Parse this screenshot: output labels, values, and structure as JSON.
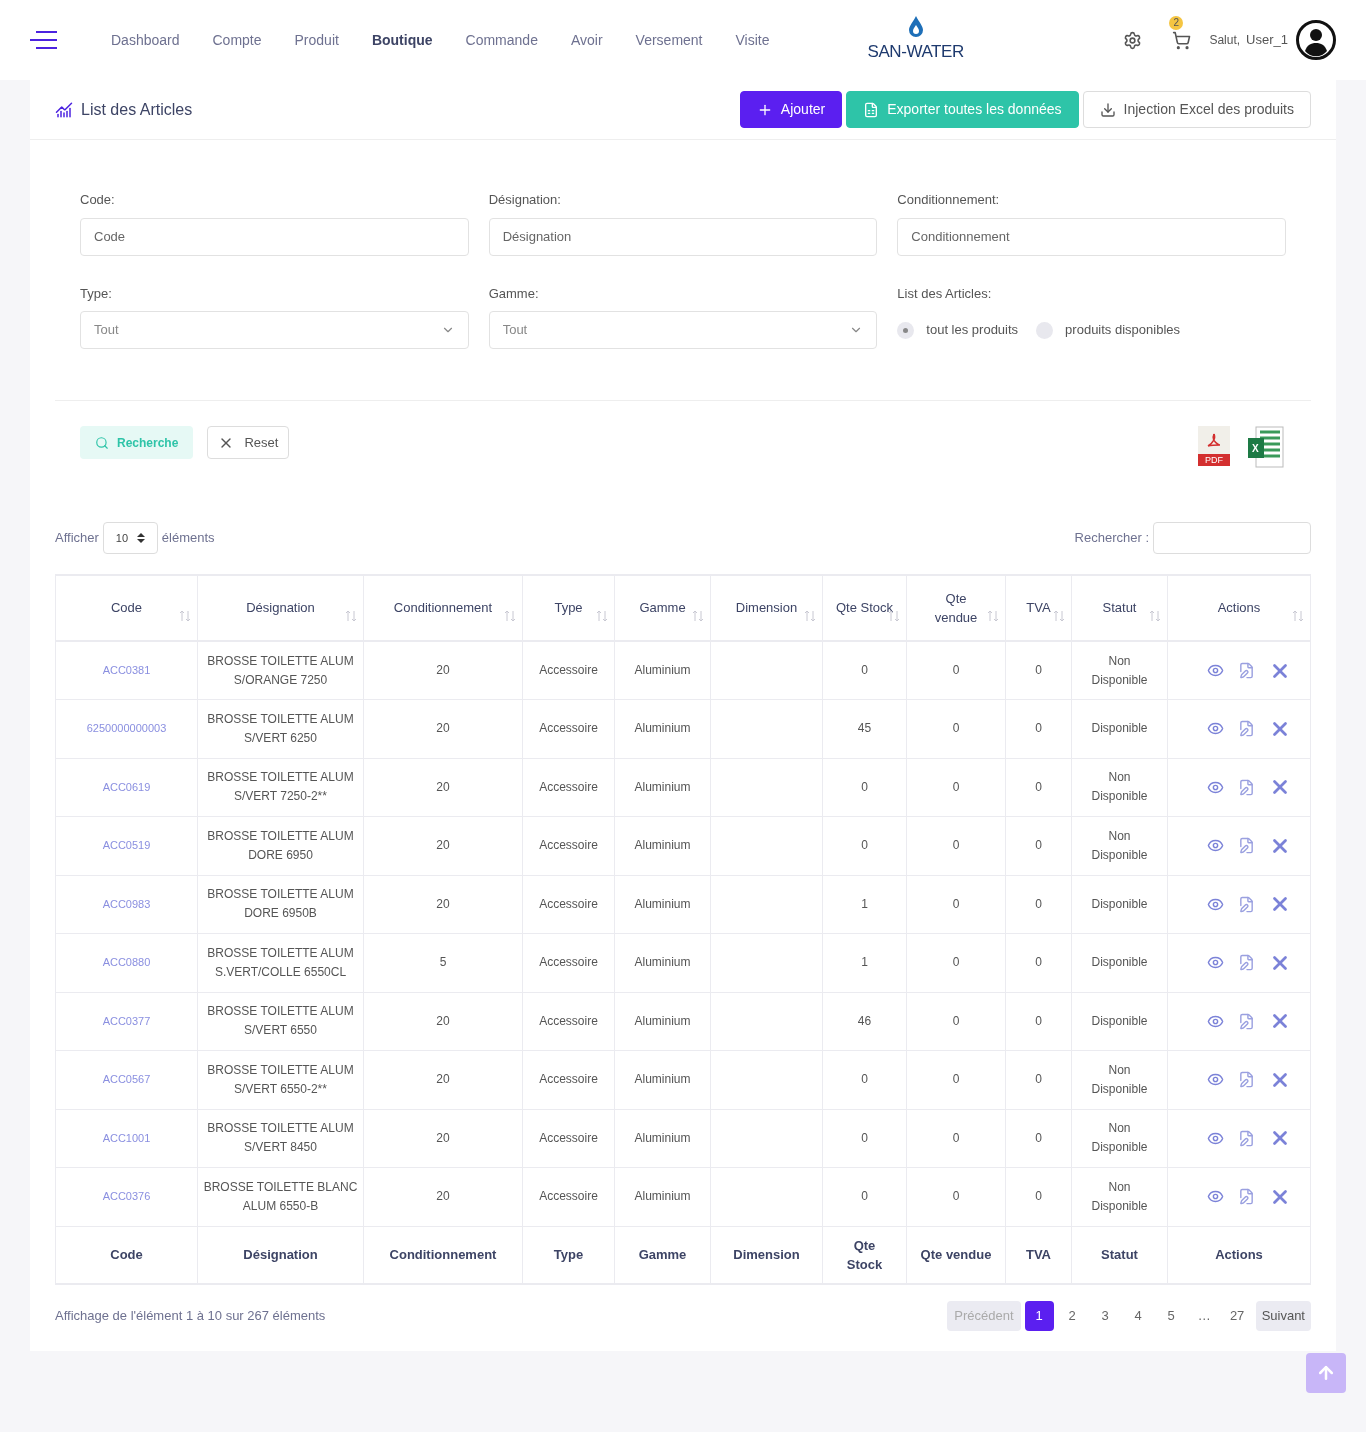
{
  "nav": {
    "items": [
      {
        "label": "Dashboard",
        "selected": false
      },
      {
        "label": "Compte",
        "selected": false
      },
      {
        "label": "Produit",
        "selected": false
      },
      {
        "label": "Boutique",
        "selected": true
      },
      {
        "label": "Commande",
        "selected": false
      },
      {
        "label": "Avoir",
        "selected": false
      },
      {
        "label": "Versement",
        "selected": false
      },
      {
        "label": "Visite",
        "selected": false
      }
    ],
    "logo": "SAN-WATER",
    "cart_count": "2",
    "greeting": "Salut,",
    "user": "User_1"
  },
  "page": {
    "title": "List des Articles",
    "buttons": [
      {
        "label": "Ajouter",
        "kind": "add"
      },
      {
        "label": "Exporter toutes les données",
        "kind": "export"
      },
      {
        "label": "Injection Excel des produits",
        "kind": "import"
      }
    ]
  },
  "filters": {
    "fields": [
      {
        "label": "Code:",
        "placeholder": "Code",
        "kind": "text"
      },
      {
        "label": "Désignation:",
        "placeholder": "Désignation",
        "kind": "text"
      },
      {
        "label": "Conditionnement:",
        "placeholder": "Conditionnement",
        "kind": "text"
      },
      {
        "label": "Type:",
        "value": "Tout",
        "kind": "select"
      },
      {
        "label": "Gamme:",
        "value": "Tout",
        "kind": "select"
      }
    ],
    "radio_label": "List des Articles:",
    "radios": [
      {
        "label": "tout les produits",
        "selected": true
      },
      {
        "label": "produits disponibles",
        "selected": false
      }
    ],
    "search_button": "Recherche",
    "reset_button": "Reset",
    "pdf_label": "PDF",
    "excel_label": "X"
  },
  "table": {
    "show_label": "Afficher",
    "page_size": "10",
    "elements_label": "éléments",
    "search_label": "Rechercher :",
    "columns": [
      "Code",
      "Désignation",
      "Conditionnement",
      "Type",
      "Gamme",
      "Dimension",
      "Qte Stock",
      "Qte vendue",
      "TVA",
      "Statut",
      "Actions"
    ],
    "rows": [
      [
        "ACC0381",
        "BROSSE TOILETTE ALUM S/ORANGE 7250",
        "20",
        "Accessoire",
        "Aluminium",
        "",
        "0",
        "0",
        "0",
        "Non Disponible"
      ],
      [
        "6250000000003",
        "BROSSE TOILETTE ALUM S/VERT 6250",
        "20",
        "Accessoire",
        "Aluminium",
        "",
        "45",
        "0",
        "0",
        "Disponible"
      ],
      [
        "ACC0619",
        "BROSSE TOILETTE ALUM S/VERT 7250-2**",
        "20",
        "Accessoire",
        "Aluminium",
        "",
        "0",
        "0",
        "0",
        "Non Disponible"
      ],
      [
        "ACC0519",
        "BROSSE TOILETTE ALUM DORE 6950",
        "20",
        "Accessoire",
        "Aluminium",
        "",
        "0",
        "0",
        "0",
        "Non Disponible"
      ],
      [
        "ACC0983",
        "BROSSE TOILETTE ALUM DORE 6950B",
        "20",
        "Accessoire",
        "Aluminium",
        "",
        "1",
        "0",
        "0",
        "Disponible"
      ],
      [
        "ACC0880",
        "BROSSE TOILETTE ALUM S.VERT/COLLE 6550CL",
        "5",
        "Accessoire",
        "Aluminium",
        "",
        "1",
        "0",
        "0",
        "Disponible"
      ],
      [
        "ACC0377",
        "BROSSE TOILETTE ALUM S/VERT 6550",
        "20",
        "Accessoire",
        "Aluminium",
        "",
        "46",
        "0",
        "0",
        "Disponible"
      ],
      [
        "ACC0567",
        "BROSSE TOILETTE ALUM S/VERT 6550-2**",
        "20",
        "Accessoire",
        "Aluminium",
        "",
        "0",
        "0",
        "0",
        "Non Disponible"
      ],
      [
        "ACC1001",
        "BROSSE TOILETTE ALUM S/VERT 8450",
        "20",
        "Accessoire",
        "Aluminium",
        "",
        "0",
        "0",
        "0",
        "Non Disponible"
      ],
      [
        "ACC0376",
        "BROSSE TOILETTE BLANC ALUM 6550-B",
        "20",
        "Accessoire",
        "Aluminium",
        "",
        "0",
        "0",
        "0",
        "Non Disponible"
      ]
    ],
    "footer_columns": [
      "Code",
      "Désignation",
      "Conditionnement",
      "Type",
      "Gamme",
      "Dimension",
      "Qte Stock",
      "Qte vendue",
      "TVA",
      "Statut",
      "Actions"
    ]
  },
  "pagination": {
    "info": "Affichage de l'élément 1 à 10 sur 267 éléments",
    "previous": {
      "label": "Précédent",
      "disabled": true
    },
    "pages": [
      {
        "label": "1",
        "selected": true
      },
      {
        "label": "2",
        "selected": false
      },
      {
        "label": "3",
        "selected": false
      },
      {
        "label": "4",
        "selected": false
      },
      {
        "label": "5",
        "selected": false
      },
      {
        "label": "…",
        "selected": false
      },
      {
        "label": "27",
        "selected": false
      }
    ],
    "next": {
      "label": "Suivant",
      "disabled": false
    }
  }
}
